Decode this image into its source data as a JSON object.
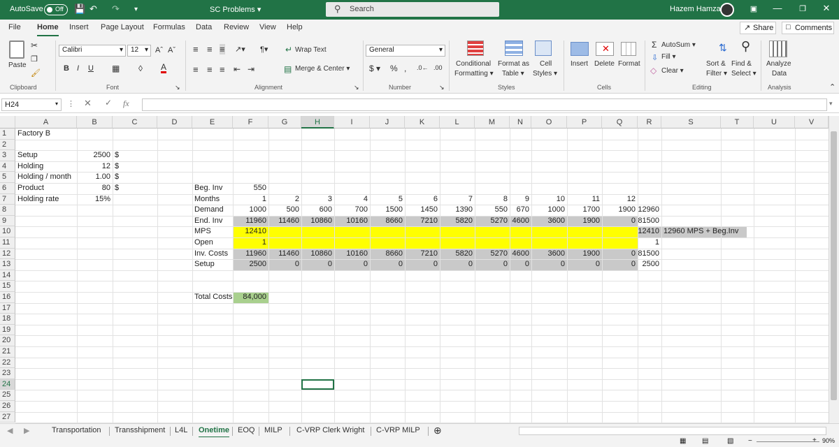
{
  "titlebar": {
    "autosave_label": "AutoSave",
    "autosave_state": "Off",
    "doc_title": "SC Problems",
    "search_placeholder": "Search",
    "user_name": "Hazem Hamza"
  },
  "menu": {
    "tabs": [
      "File",
      "Home",
      "Insert",
      "Page Layout",
      "Formulas",
      "Data",
      "Review",
      "View",
      "Help"
    ],
    "active": "Home",
    "share_label": "Share",
    "comments_label": "Comments"
  },
  "ribbon": {
    "paste_label": "Paste",
    "font_name": "Calibri",
    "font_size": "12",
    "wrap_text": "Wrap Text",
    "merge_center": "Merge & Center",
    "number_format": "General",
    "conditional_formatting_1": "Conditional",
    "conditional_formatting_2": "Formatting",
    "format_as_table_1": "Format as",
    "format_as_table_2": "Table",
    "cell_styles_1": "Cell",
    "cell_styles_2": "Styles",
    "insert": "Insert",
    "delete": "Delete",
    "format": "Format",
    "autosum": "AutoSum",
    "fill": "Fill",
    "clear": "Clear",
    "sort_filter_1": "Sort &",
    "sort_filter_2": "Filter",
    "find_select_1": "Find &",
    "find_select_2": "Select",
    "analyze_1": "Analyze",
    "analyze_2": "Data",
    "groups": {
      "clipboard": "Clipboard",
      "font": "Font",
      "alignment": "Alignment",
      "number": "Number",
      "styles": "Styles",
      "cells": "Cells",
      "editing": "Editing",
      "analysis": "Analysis"
    }
  },
  "formula_bar": {
    "name_box": "H24",
    "fx": "fx",
    "formula": ""
  },
  "columns": [
    "A",
    "B",
    "C",
    "D",
    "E",
    "F",
    "G",
    "H",
    "I",
    "J",
    "K",
    "L",
    "M",
    "N",
    "O",
    "P",
    "Q",
    "R",
    "S",
    "T",
    "U",
    "V"
  ],
  "rows": [
    "1",
    "2",
    "3",
    "4",
    "5",
    "6",
    "7",
    "8",
    "9",
    "10",
    "11",
    "12",
    "13",
    "14",
    "15",
    "16",
    "17",
    "18",
    "19",
    "20",
    "21",
    "22",
    "23",
    "24",
    "25",
    "26",
    "27"
  ],
  "cells": {
    "A1": "Factory B",
    "A3": "Setup",
    "B3": "2500",
    "C3": "$",
    "A4": "Holding",
    "B4": "12",
    "C4": "$",
    "A5": "Holding / month",
    "B5": "1.00",
    "C5": "$",
    "A6": "Product",
    "B6": "80",
    "C6": "$",
    "A7": "Holding rate",
    "B7": "15%",
    "E6": "Beg. Inv",
    "F6": "550",
    "E7": "Months",
    "E8": "Demand",
    "E9": "End. Inv",
    "E10": "MPS",
    "F10": "12410",
    "E11": "Open",
    "F11": "1",
    "E12": "Inv. Costs",
    "E13": "Setup",
    "E16": "Total Costs",
    "F16": "84,000",
    "R8": "12960",
    "R9": "81500",
    "R10": "12410",
    "R11": "1",
    "R12": "81500",
    "R13": "2500",
    "S10": "12960 MPS + Beg.Inv"
  },
  "months": [
    "1",
    "2",
    "3",
    "4",
    "5",
    "6",
    "7",
    "8",
    "9",
    "10",
    "11",
    "12"
  ],
  "demand": [
    "1000",
    "500",
    "600",
    "700",
    "1500",
    "1450",
    "1390",
    "550",
    "670",
    "1000",
    "1700",
    "1900"
  ],
  "end_inv": [
    "11960",
    "11460",
    "10860",
    "10160",
    "8660",
    "7210",
    "5820",
    "5270",
    "4600",
    "3600",
    "1900",
    "0"
  ],
  "inv_costs": [
    "11960",
    "11460",
    "10860",
    "10160",
    "8660",
    "7210",
    "5820",
    "5270",
    "4600",
    "3600",
    "1900",
    "0"
  ],
  "setup": [
    "2500",
    "0",
    "0",
    "0",
    "0",
    "0",
    "0",
    "0",
    "0",
    "0",
    "0",
    "0"
  ],
  "sheet_tabs": [
    "Transportation",
    "Transshipment",
    "L4L",
    "Onetime",
    "EOQ",
    "MILP",
    "C-VRP Clerk Wright",
    "C-VRP MILP"
  ],
  "active_sheet": "Onetime",
  "status": {
    "zoom": "90%"
  },
  "colors": {
    "excel_green": "#217346",
    "yellow": "#ffff00",
    "gray_fill": "#c9c9c9",
    "green_fill": "#a9d08e"
  }
}
